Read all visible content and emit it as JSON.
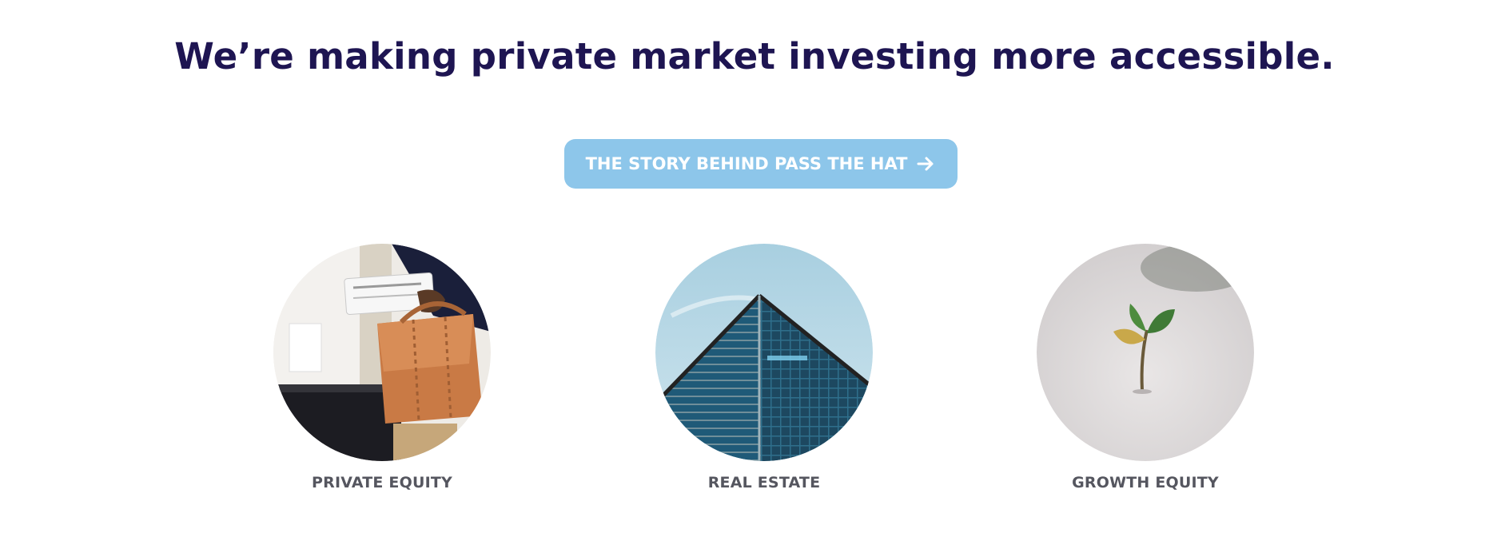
{
  "hero": {
    "headline": "We’re making private market investing more accessible."
  },
  "cta": {
    "label": "THE STORY BEHIND PASS THE HAT",
    "icon": "arrow-right-icon",
    "background": "#8dc6ea"
  },
  "categories": [
    {
      "label": "PRIVATE EQUITY",
      "image": "briefcase-photo"
    },
    {
      "label": "REAL ESTATE",
      "image": "skyscraper-photo"
    },
    {
      "label": "GROWTH EQUITY",
      "image": "sprout-photo"
    }
  ],
  "colors": {
    "headline": "#1e1552",
    "label": "#55565f"
  }
}
